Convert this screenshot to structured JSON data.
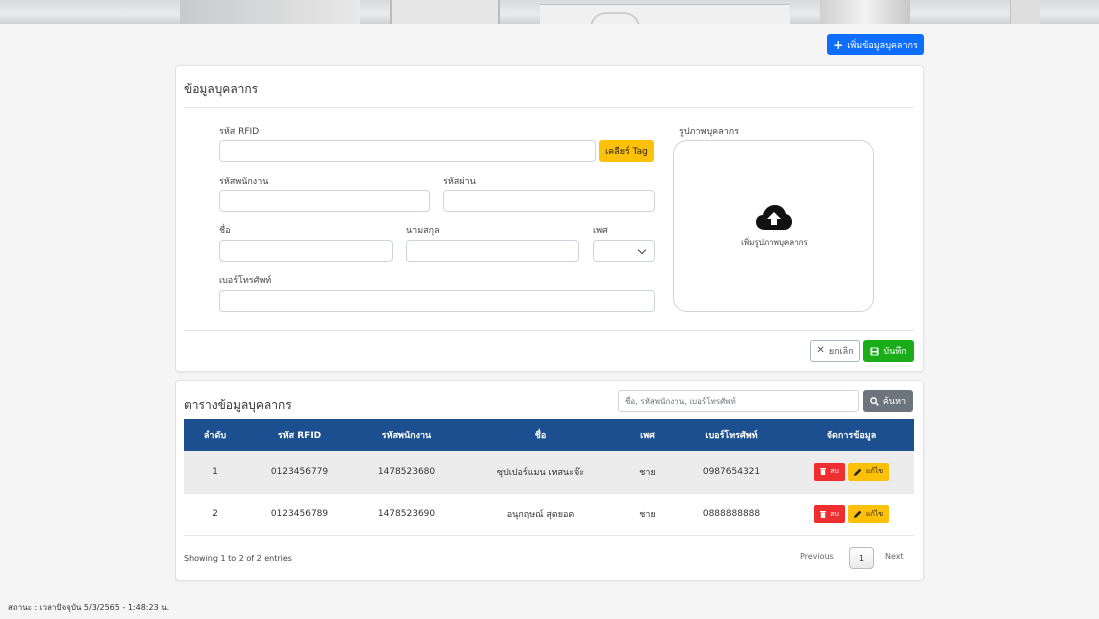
{
  "header": {
    "add_button_label": "เพิ่มข้อมูลบุคลากร"
  },
  "form": {
    "title": "ข้อมูลบุคลากร",
    "rfid_label": "รหัส RFID",
    "rfid_value": "",
    "clear_tag_label": "เคลียร์ Tag",
    "employee_code_label": "รหัสพนักงาน",
    "employee_code_value": "",
    "password_label": "รหัสผ่าน",
    "password_value": "",
    "first_name_label": "ชื่อ",
    "first_name_value": "",
    "last_name_label": "นามสกุล",
    "last_name_value": "",
    "gender_label": "เพศ",
    "gender_value": "",
    "phone_label": "เบอร์โทรศัพท์",
    "phone_value": "",
    "photo_label": "รูปภาพบุคลากร",
    "photo_upload_text": "เพิ่มรูปภาพบุคลากร",
    "cancel_label": "ยกเลิก",
    "save_label": "บันทึก"
  },
  "table_section": {
    "title": "ตารางข้อมูลบุคลากร",
    "search_placeholder": "ชื่อ, รหัสพนักงาน, เบอร์โทรศัพท์",
    "search_button_label": "ค้นหา",
    "columns": [
      "ลำดับ",
      "รหัส RFID",
      "รหัสพนักงาน",
      "ชื่อ",
      "เพศ",
      "เบอร์โทรศัพท์",
      "จัดการข้อมูล"
    ],
    "rows": [
      {
        "no": "1",
        "rfid": "0123456779",
        "emp_code": "1478523680",
        "name": "ซุปเปอร์แมน เทสนะจ๊ะ",
        "gender": "ชาย",
        "phone": "0987654321"
      },
      {
        "no": "2",
        "rfid": "0123456789",
        "emp_code": "1478523690",
        "name": "อนุกฤษณ์ สุดยอด",
        "gender": "ชาย",
        "phone": "0888888888"
      }
    ],
    "delete_label": "ลบ",
    "edit_label": "แก้ไข",
    "info": "Showing 1 to 2 of 2 entries",
    "prev_label": "Previous",
    "page": "1",
    "next_label": "Next"
  },
  "footer": {
    "status": "สถานะ : เวลาปัจจุบัน 5/3/2565 - 1:48:23 น."
  },
  "colors": {
    "primary": "#0d6efd",
    "warning": "#ffc107",
    "success": "#1aad19",
    "danger": "#ef2f2f",
    "table_header": "#1b4f8f",
    "secondary": "#6c757d"
  },
  "icons": {
    "add": "plus-icon",
    "cancel": "close-icon",
    "save": "floppy-icon",
    "search": "search-icon",
    "upload": "cloud-upload-icon",
    "delete": "trash-icon",
    "edit": "pencil-icon",
    "gender_select": "chevron-down-icon"
  }
}
